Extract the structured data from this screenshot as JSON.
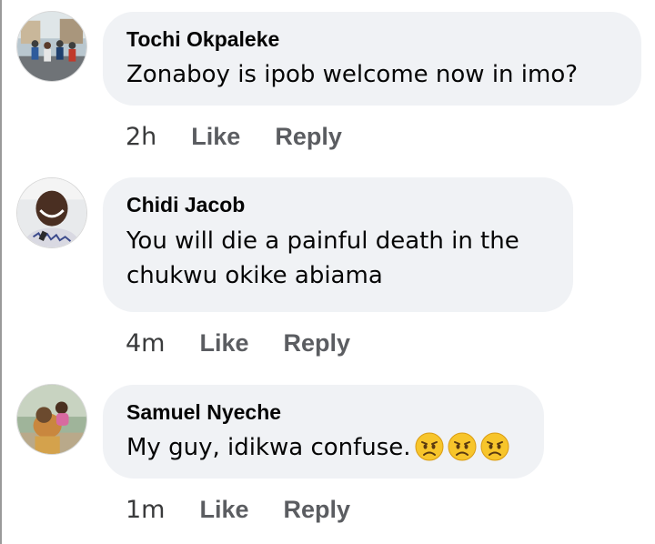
{
  "comments": [
    {
      "author": "Tochi Okpaleke",
      "text_lines": [
        "Zonaboy is ipob welcome now in imo?"
      ],
      "time": "2h",
      "like_label": "Like",
      "reply_label": "Reply",
      "avatar_icon": "runners-photo-avatar"
    },
    {
      "author": "Chidi Jacob",
      "text_lines": [
        "You will die a painful death in the",
        "chukwu okike abiama"
      ],
      "time": "4m",
      "like_label": "Like",
      "reply_label": "Reply",
      "avatar_icon": "smiling-man-avatar"
    },
    {
      "author": "Samuel Nyeche",
      "text_lines": [
        "My guy, idikwa confuse."
      ],
      "emojis": [
        "frowning-face-emoji",
        "frowning-face-emoji",
        "frowning-face-emoji"
      ],
      "time": "1m",
      "like_label": "Like",
      "reply_label": "Reply",
      "avatar_icon": "woman-with-child-avatar"
    }
  ],
  "colors": {
    "bubble_bg": "#f0f2f5",
    "action_text": "#5b5d61",
    "primary_text": "#050505"
  }
}
